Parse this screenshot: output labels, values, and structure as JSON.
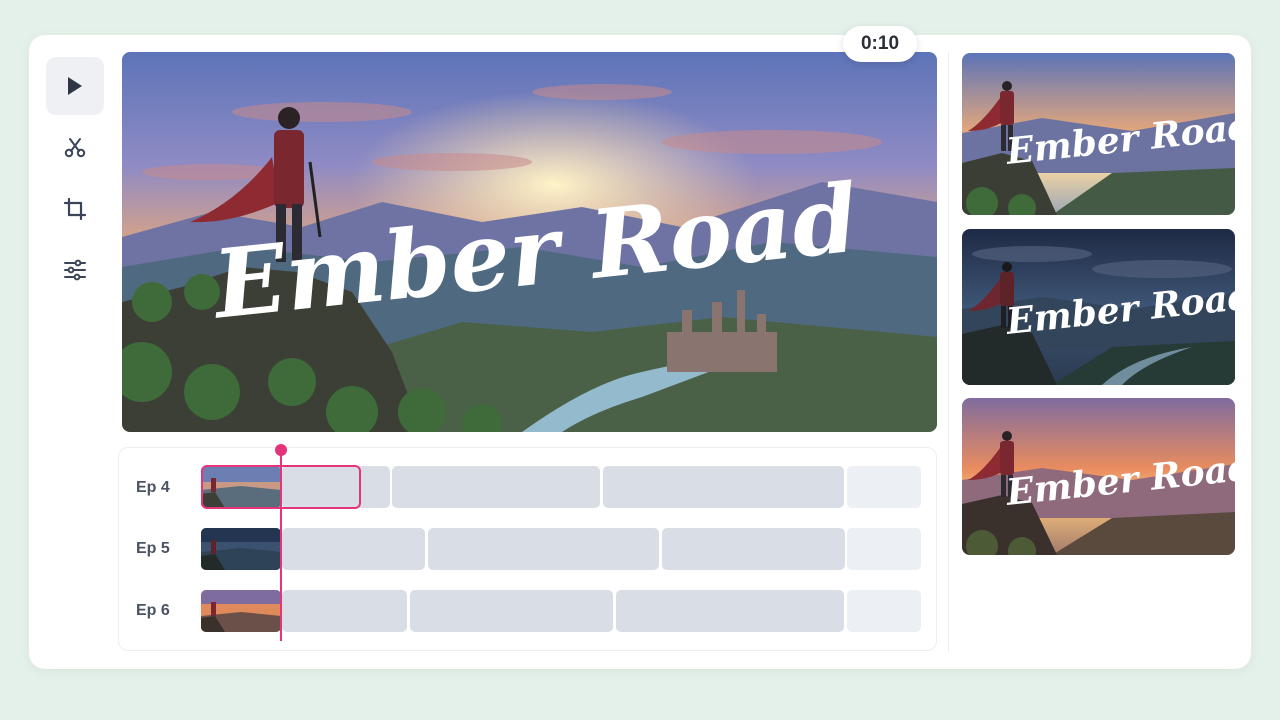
{
  "timer": "0:10",
  "title_text": "Ember Road",
  "toolbar": {
    "items": [
      {
        "name": "play-icon"
      },
      {
        "name": "scissors-icon"
      },
      {
        "name": "crop-icon"
      },
      {
        "name": "sliders-icon"
      }
    ]
  },
  "timeline": {
    "tracks": [
      {
        "label": "Ep 4"
      },
      {
        "label": "Ep 5"
      },
      {
        "label": "Ep 6"
      }
    ]
  },
  "colors": {
    "accent": "#e5347a",
    "segment": "#d9dee6",
    "background": "#e4f1ea"
  }
}
